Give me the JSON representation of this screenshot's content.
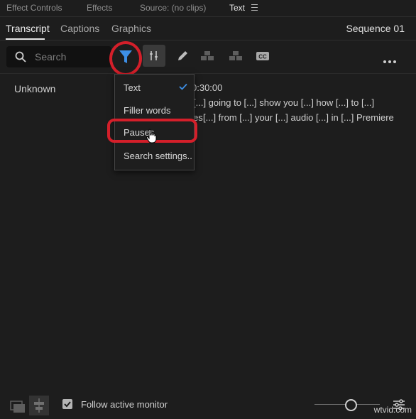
{
  "panel_tabs": [
    {
      "label": "Effect Controls"
    },
    {
      "label": "Effects"
    },
    {
      "label": "Source: (no clips)"
    },
    {
      "label": "Text"
    }
  ],
  "subtabs": [
    {
      "label": "Transcript"
    },
    {
      "label": "Captions"
    },
    {
      "label": "Graphics"
    }
  ],
  "sequence_name": "Sequence 01",
  "search": {
    "placeholder": "Search"
  },
  "transcript": {
    "speaker": "Unknown",
    "timecode": "0:30:00",
    "line1": "[...] going to [...] show you [...] how [...] to [...]",
    "line2_start": "es",
    "line2": "[...] from [...] your [...] audio [...] in [...] Premiere"
  },
  "filter_menu": {
    "items": [
      {
        "label": "Text",
        "checked": true
      },
      {
        "label": "Filler words",
        "checked": false
      },
      {
        "label": "Pauses",
        "checked": false
      },
      {
        "label": "Search settings..",
        "checked": false
      }
    ]
  },
  "footer": {
    "follow_monitor_label": "Follow active monitor",
    "follow_monitor_checked": true,
    "watermark": "wtvid.com"
  },
  "colors": {
    "accent_blue": "#3d8fe6",
    "highlight_red": "#d41f2a"
  }
}
